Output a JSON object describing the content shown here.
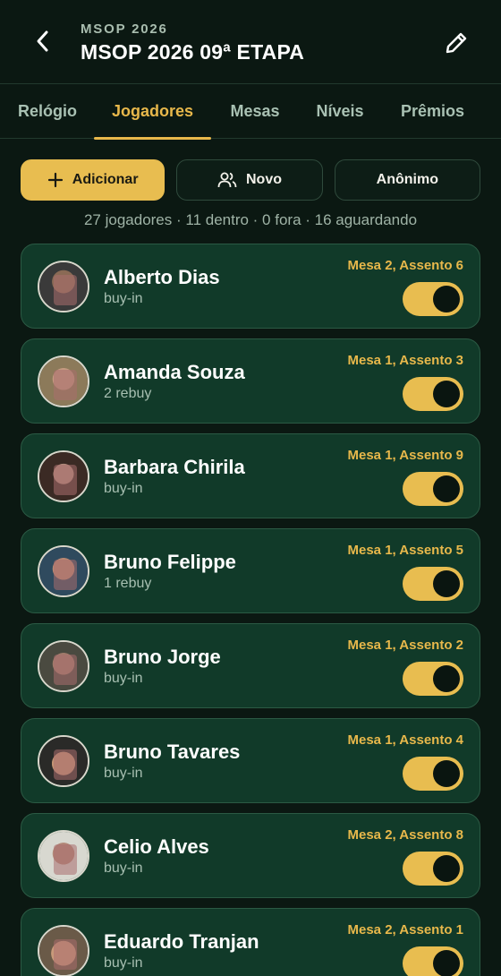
{
  "header": {
    "subtitle": "MSOP 2026",
    "title": "MSOP 2026 09ª ETAPA"
  },
  "tabs": [
    {
      "label": "Relógio",
      "active": false
    },
    {
      "label": "Jogadores",
      "active": true
    },
    {
      "label": "Mesas",
      "active": false
    },
    {
      "label": "Níveis",
      "active": false
    },
    {
      "label": "Prêmios",
      "active": false
    }
  ],
  "actions": {
    "add_label": "Adicionar",
    "new_label": "Novo",
    "anon_label": "Anônimo"
  },
  "summary": "27 jogadores · 11 dentro · 0 fora · 16 aguardando",
  "players": [
    {
      "name": "Alberto Dias",
      "status": "buy-in",
      "seat": "Mesa 2, Assento 6",
      "active": true
    },
    {
      "name": "Amanda Souza",
      "status": "2 rebuy",
      "seat": "Mesa 1, Assento 3",
      "active": true
    },
    {
      "name": "Barbara Chirila",
      "status": "buy-in",
      "seat": "Mesa 1, Assento 9",
      "active": true
    },
    {
      "name": "Bruno Felippe",
      "status": "1 rebuy",
      "seat": "Mesa 1, Assento 5",
      "active": true
    },
    {
      "name": "Bruno Jorge",
      "status": "buy-in",
      "seat": "Mesa 1, Assento 2",
      "active": true
    },
    {
      "name": "Bruno Tavares",
      "status": "buy-in",
      "seat": "Mesa 1, Assento 4",
      "active": true
    },
    {
      "name": "Celio Alves",
      "status": "buy-in",
      "seat": "Mesa 2, Assento 8",
      "active": true
    },
    {
      "name": "Eduardo Tranjan",
      "status": "buy-in",
      "seat": "Mesa 2, Assento 1",
      "active": true
    }
  ],
  "colors": {
    "background": "#0b1812",
    "card": "#113a29",
    "accent": "#e8b84b"
  }
}
